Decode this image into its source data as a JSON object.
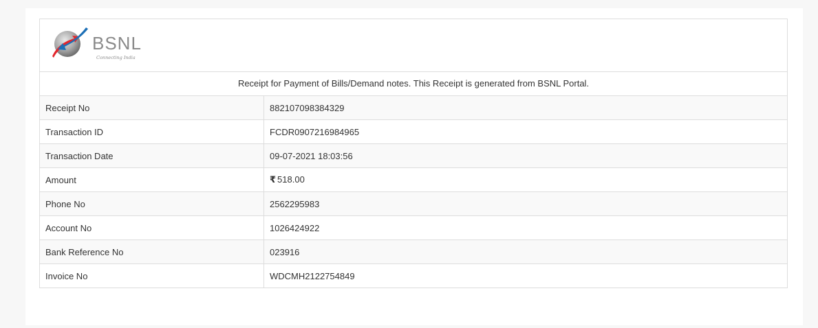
{
  "brand": {
    "name": "BSNL",
    "tagline": "Connecting India",
    "colors": {
      "blue": "#1c6fb6",
      "red": "#e3262b",
      "grey": "#8a8a8a"
    }
  },
  "receipt": {
    "caption": "Receipt for Payment of Bills/Demand notes. This Receipt is generated from BSNL Portal.",
    "rows": [
      {
        "label": "Receipt No",
        "value": "882107098384329"
      },
      {
        "label": "Transaction ID",
        "value": "FCDR0907216984965"
      },
      {
        "label": "Transaction Date",
        "value": "09-07-2021 18:03:56"
      },
      {
        "label": "Amount",
        "currency": "₹",
        "value": "518.00"
      },
      {
        "label": "Phone No",
        "value": "2562295983"
      },
      {
        "label": "Account No",
        "value": "1026424922"
      },
      {
        "label": "Bank Reference No",
        "value": "023916"
      },
      {
        "label": "Invoice No",
        "value": "WDCMH2122754849"
      }
    ]
  }
}
